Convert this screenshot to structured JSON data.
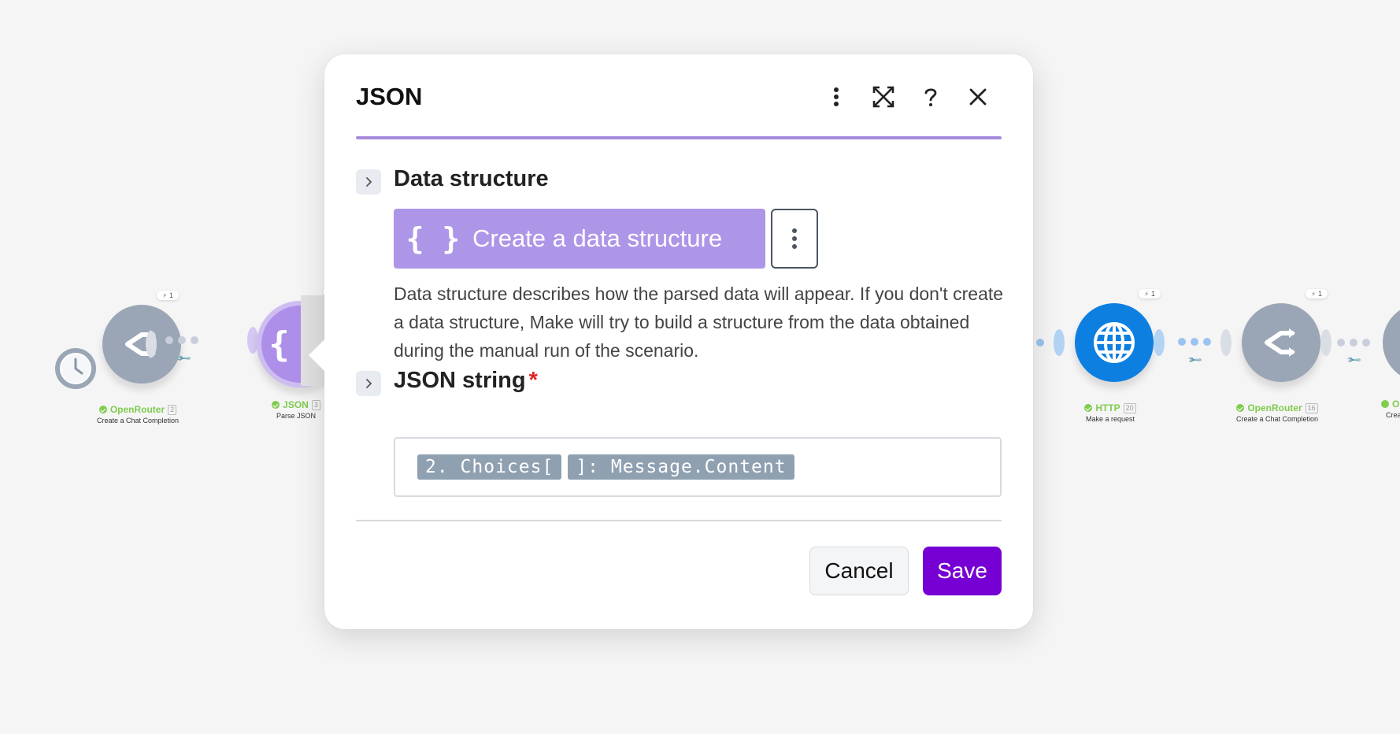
{
  "scenario": {
    "modules": [
      {
        "name": "OpenRouter",
        "number": "2",
        "description": "Create a Chat Completion",
        "ops": "1",
        "color": "#9aa6b5",
        "icon": "share-arrows-icon"
      },
      {
        "name": "JSON",
        "number": "3",
        "description": "Parse JSON",
        "ops": "1",
        "color": "#ad8ee8",
        "icon": "braces-icon"
      },
      {
        "name": "HTTP",
        "number": "20",
        "description": "Make a request",
        "ops": "1",
        "color": "#0d7fe0",
        "icon": "globe-icon"
      },
      {
        "name": "OpenRouter",
        "number": "16",
        "description": "Create a Chat Completion",
        "ops": "1",
        "color": "#9aa6b5",
        "icon": "share-arrows-icon"
      },
      {
        "name": "O",
        "description": "Crea",
        "color": "#9aa6b5"
      }
    ],
    "trigger_icon": "clock-icon"
  },
  "dialog": {
    "title": "JSON",
    "header_icons": [
      "more-vertical-icon",
      "expand-icon",
      "help-icon",
      "close-icon"
    ],
    "accent_color": "#a78bdb",
    "data_structure": {
      "label": "Data structure",
      "create_button": "Create a data structure",
      "create_button_icon": "{ }",
      "help": "Data structure describes how the parsed data will appear. If you don't create a data structure, Make will try to build a structure from the data obtained during the manual run of the scenario."
    },
    "json_string": {
      "label": "JSON string",
      "required_marker": "*",
      "pills": [
        "2. Choices[",
        "]: Message.Content"
      ]
    },
    "buttons": {
      "cancel": "Cancel",
      "save": "Save"
    },
    "save_color": "#7600d4"
  }
}
